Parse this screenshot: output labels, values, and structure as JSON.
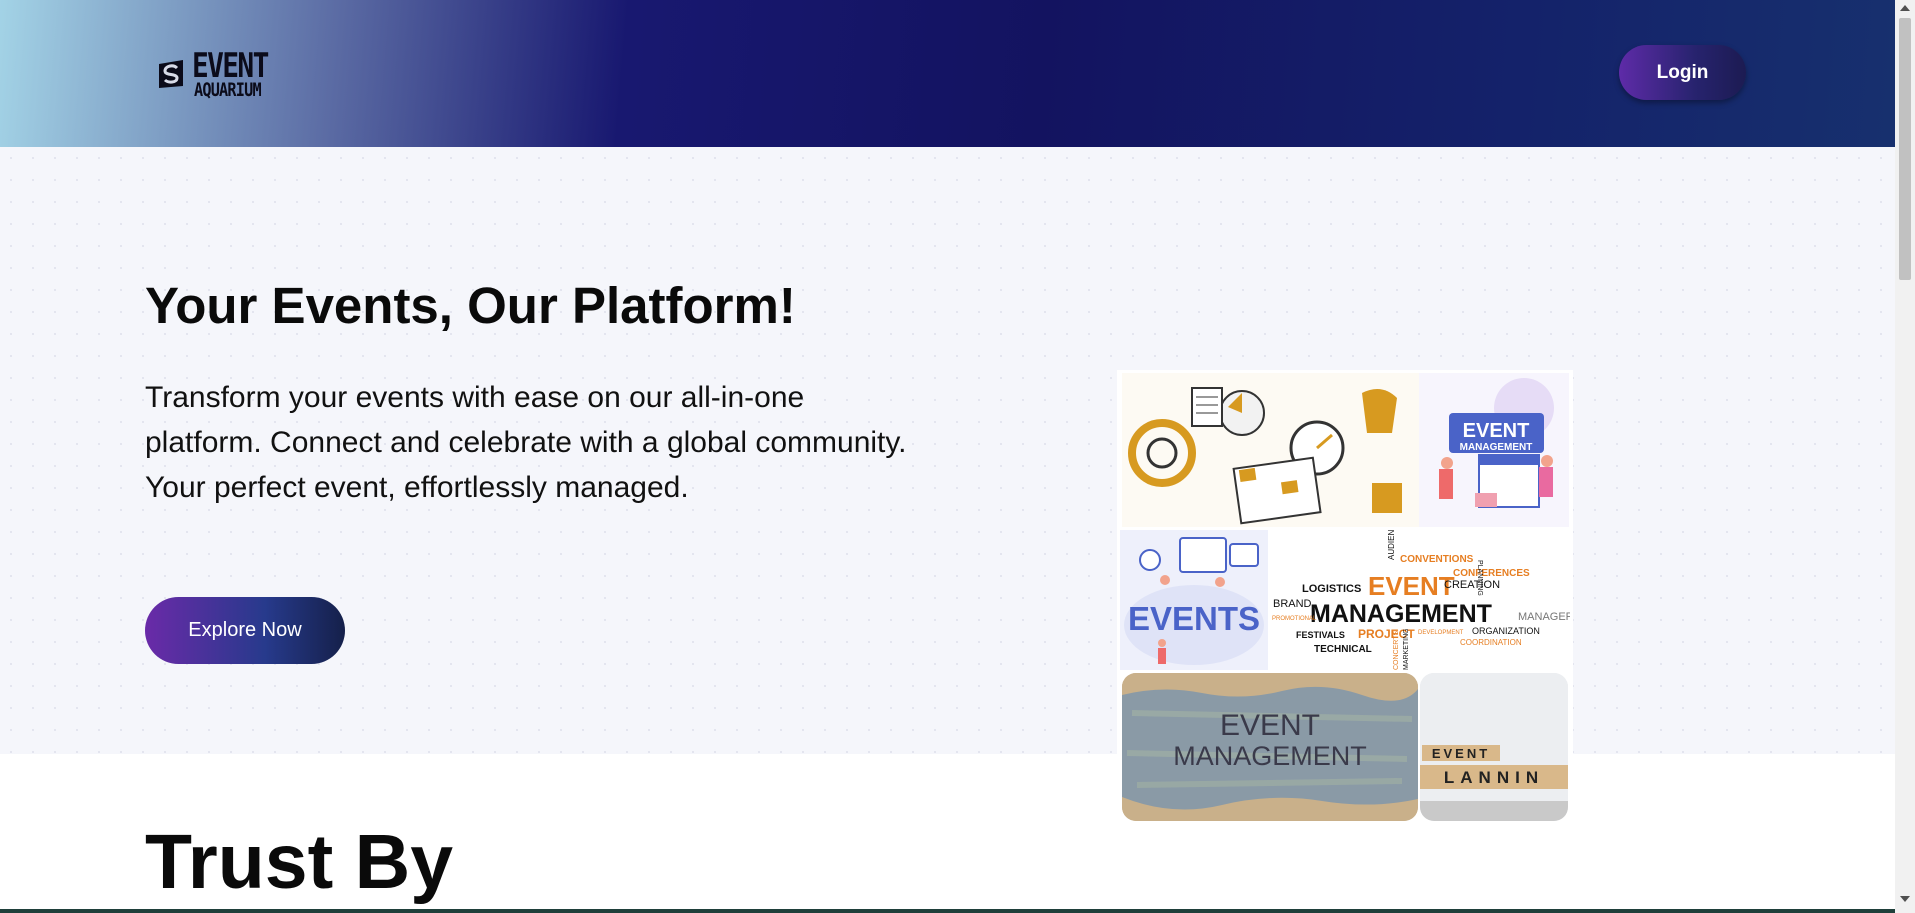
{
  "header": {
    "logo": {
      "word": "EVENT",
      "sub": "AQUARIUM"
    },
    "login_label": "Login",
    "colors": {
      "gradient_start": "#a3d3e6",
      "gradient_mid": "#181870",
      "gradient_end": "#17306e"
    }
  },
  "hero": {
    "title": "Your Events, Our Platform!",
    "description": "Transform your events with ease on our all-in-one platform. Connect and celebrate with a global community. Your perfect event, effortlessly managed.",
    "cta_label": "Explore Now",
    "collage": {
      "tile2": {
        "line1": "EVENT",
        "line2": "MANAGEMENT"
      },
      "tile3": {
        "text": "EVENTS"
      },
      "tile4": {
        "main1": "EVENT",
        "main2": "MANAGEMENT",
        "words": [
          "CONVENTIONS",
          "CONFERENCES",
          "LOGISTICS",
          "CREATION",
          "BRAND",
          "MANAGER",
          "FESTIVALS",
          "PROJECT",
          "TECHNICAL",
          "ORGANIZATION",
          "COORDINATION",
          "PROMOTIONAL",
          "DEVELOPMENT",
          "AUDIENCE",
          "PLANNING",
          "CONCERTS",
          "MARKETING"
        ]
      },
      "tile5": {
        "line1": "EVENT",
        "line2": "MANAGEMENT"
      },
      "tile6": {
        "line1": "EVENT",
        "line2": "LANNIN"
      }
    }
  },
  "trust": {
    "title": "Trust By"
  },
  "colors": {
    "accent_purple": "#6a2aa8",
    "navy": "#15204a",
    "hero_bg": "#f5f6fb"
  }
}
